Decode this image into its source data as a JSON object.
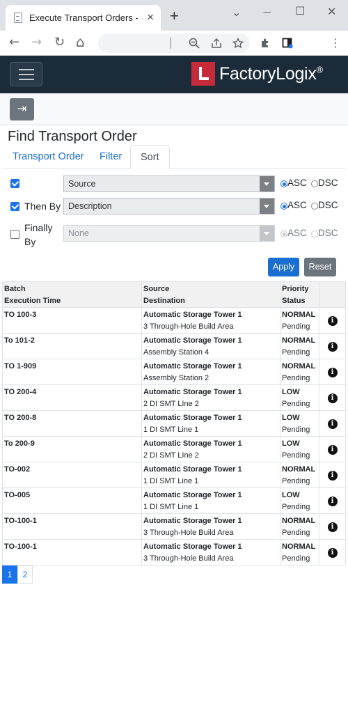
{
  "browser": {
    "tab_title": "Execute Transport Orders - FactoryLogix",
    "new_tab": "+",
    "window_controls": {
      "caret": "⌄",
      "minimize": "—",
      "maximize": "☐",
      "close": "✕"
    },
    "nav": {
      "back": "←",
      "forward": "→",
      "reload": "↻",
      "home": "⌂"
    }
  },
  "app": {
    "logo_prefix": "Factory",
    "logo_bold": "Logix",
    "logo_reg": "®"
  },
  "page": {
    "title": "Find Transport Order",
    "tabs": [
      "Transport Order",
      "Filter",
      "Sort"
    ]
  },
  "sort": {
    "rows": [
      {
        "label": "",
        "value": "Source",
        "checked": true,
        "disabled": false,
        "order": "ASC"
      },
      {
        "label": "Then By",
        "value": "Description",
        "checked": true,
        "disabled": false,
        "order": "ASC"
      },
      {
        "label": "Finally By",
        "value": "None",
        "checked": false,
        "disabled": true,
        "order": "ASC"
      }
    ],
    "asc_label": "ASC",
    "dsc_label": "DSC",
    "apply_label": "Apply",
    "reset_label": "Reset"
  },
  "table": {
    "headers": [
      {
        "line1": "Batch",
        "line2": "Execution Time"
      },
      {
        "line1": "Source",
        "line2": "Destination"
      },
      {
        "line1": "Priority",
        "line2": "Status"
      }
    ],
    "rows": [
      {
        "batch": "TO 100-3",
        "source": "Automatic Storage Tower 1",
        "destination": "3 Through-Hole Build Area",
        "priority": "NORMAL",
        "status": "Pending"
      },
      {
        "batch": "To 101-2",
        "source": "Automatic Storage Tower 1",
        "destination": "Assembly Station 4",
        "priority": "NORMAL",
        "status": "Pending"
      },
      {
        "batch": "TO 1-909",
        "source": "Automatic Storage Tower 1",
        "destination": "Assembly Station 2",
        "priority": "NORMAL",
        "status": "Pending"
      },
      {
        "batch": "TO 200-4",
        "source": "Automatic Storage Tower 1",
        "destination": "2 DI SMT LIne 2",
        "priority": "LOW",
        "status": "Pending"
      },
      {
        "batch": "TO 200-8",
        "source": "Automatic Storage Tower 1",
        "destination": "1 DI SMT Line 1",
        "priority": "LOW",
        "status": "Pending"
      },
      {
        "batch": "To 200-9",
        "source": "Automatic Storage Tower 1",
        "destination": "2 DI SMT LIne 2",
        "priority": "LOW",
        "status": "Pending"
      },
      {
        "batch": "TO-002",
        "source": "Automatic Storage Tower 1",
        "destination": "1 DI SMT Line 1",
        "priority": "NORMAL",
        "status": "Pending"
      },
      {
        "batch": "TO-005",
        "source": "Automatic Storage Tower 1",
        "destination": "1 DI SMT Line 1",
        "priority": "LOW",
        "status": "Pending"
      },
      {
        "batch": "TO-100-1",
        "source": "Automatic Storage Tower 1",
        "destination": "3 Through-Hole Build Area",
        "priority": "NORMAL",
        "status": "Pending"
      },
      {
        "batch": "TO-100-1",
        "source": "Automatic Storage Tower 1",
        "destination": "3 Through-Hole Build Area",
        "priority": "NORMAL",
        "status": "Pending"
      }
    ],
    "info_glyph": "i"
  },
  "pagination": {
    "pages": [
      "1",
      "2"
    ],
    "current": "1"
  },
  "colors": {
    "app_bar": "#1b2b39",
    "logo_red": "#c62b3a",
    "primary": "#1a73e8",
    "secondary": "#6c757d"
  }
}
